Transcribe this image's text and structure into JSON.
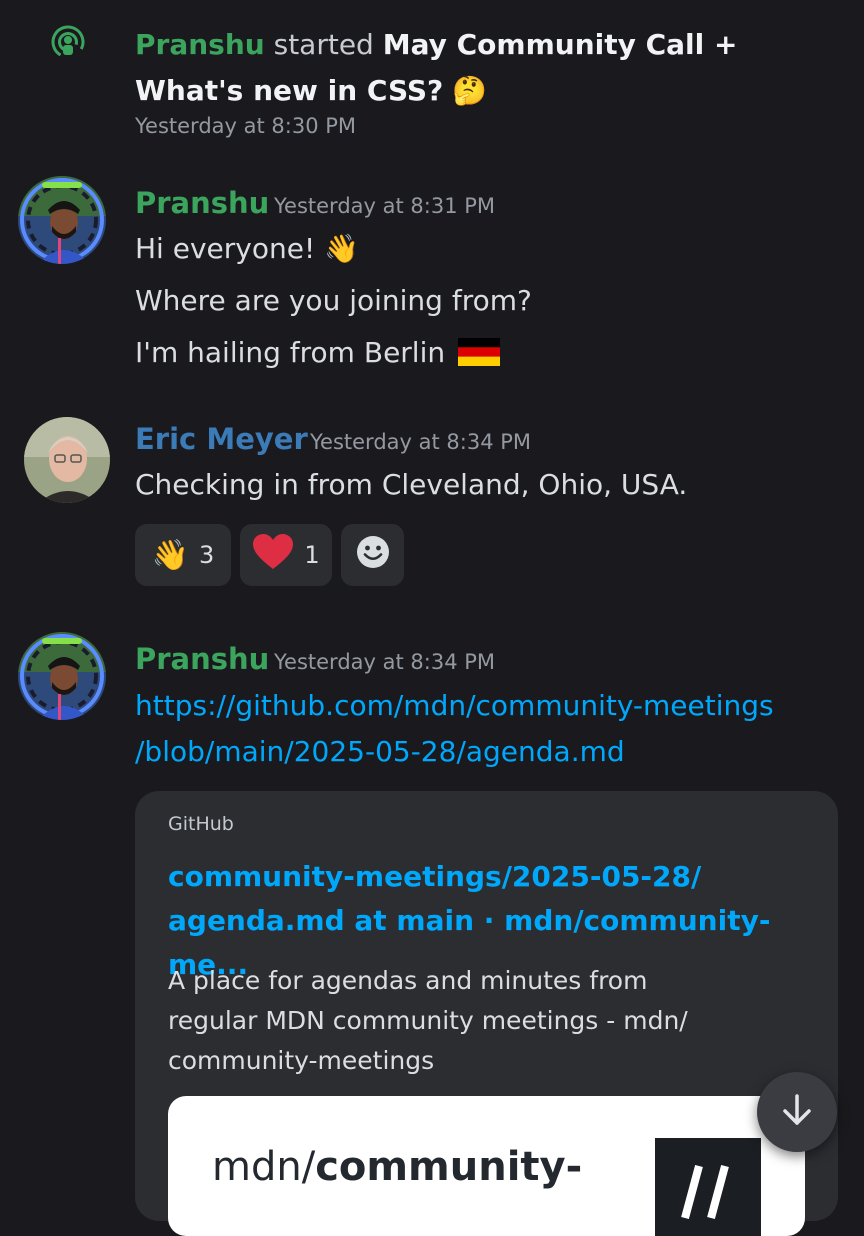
{
  "stage_event": {
    "actor": "Pranshu",
    "action": "started",
    "title": "May Community Call + What's new in CSS?",
    "emoji": "🤔",
    "timestamp": "Yesterday at 8:30 PM"
  },
  "messages": [
    {
      "author": "Pranshu",
      "timestamp": "Yesterday at 8:31 PM",
      "lines": [
        "Hi everyone!",
        "Where are you joining from?",
        "I'm hailing from Berlin"
      ]
    },
    {
      "author": "Eric Meyer",
      "timestamp": "Yesterday at 8:34 PM",
      "text": "Checking in from Cleveland, Ohio, USA.",
      "reactions": [
        {
          "emoji": "👋",
          "count": "3"
        },
        {
          "emoji": "❤",
          "count": "1"
        }
      ]
    },
    {
      "author": "Pranshu",
      "timestamp": "Yesterday at 8:34 PM",
      "link_line1": "https://github.com/mdn/community-meetings",
      "link_line2": "/blob/main/2025-05-28/agenda.md",
      "embed": {
        "provider": "GitHub",
        "title_line1": "community-meetings/2025-05-28/",
        "title_line2": "agenda.md at main · mdn/community-me...",
        "description": "A place for agendas and minutes from regular MDN community meetings - mdn/ community-meetings",
        "preview_prefix": "mdn/",
        "preview_repo": "community-"
      }
    }
  ],
  "colors": {
    "background": "#1a1a1e",
    "pranshu": "#3ba55d",
    "eric": "#3a7bb8",
    "link": "#00a8fc"
  }
}
